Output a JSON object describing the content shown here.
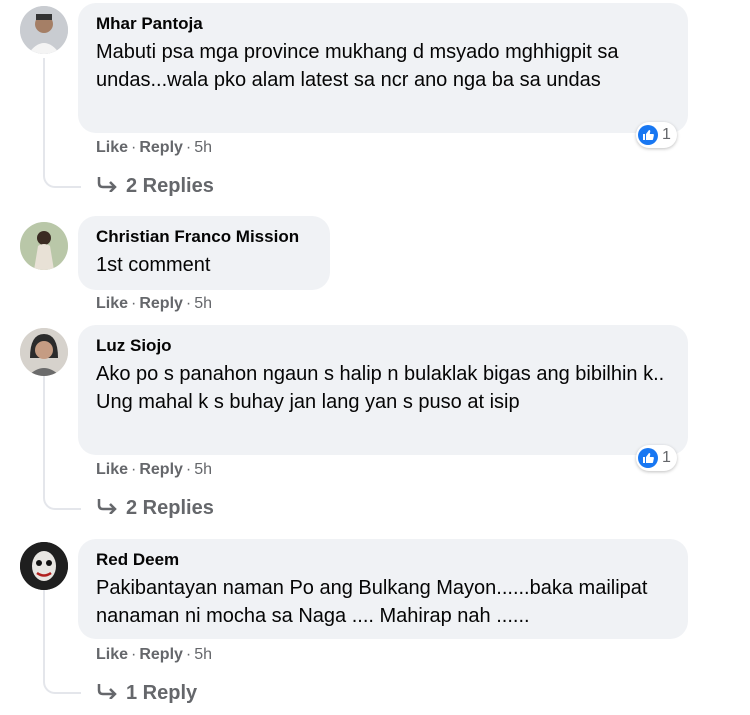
{
  "colors": {
    "bubble_bg": "#f0f2f5",
    "meta_text": "#65676b",
    "like_blue": "#1877f2"
  },
  "comments": [
    {
      "author": "Mhar Pantoja",
      "text": "Mabuti psa mga province mukhang d msyado mghhigpit sa undas...wala pko alam latest sa ncr ano nga ba sa undas",
      "like": "Like",
      "reply": "Reply",
      "time": "5h",
      "reaction_count": "1",
      "replies": "2 Replies"
    },
    {
      "author": "Christian Franco Mission",
      "text": "1st comment",
      "like": "Like",
      "reply": "Reply",
      "time": "5h"
    },
    {
      "author": "Luz Siojo",
      "text": "Ako po s panahon ngaun s halip n bulaklak bigas ang bibilhin k.. Ung mahal k s buhay jan lang yan s puso at isip",
      "like": "Like",
      "reply": "Reply",
      "time": "5h",
      "reaction_count": "1",
      "replies": "2 Replies"
    },
    {
      "author": "Red Deem",
      "text": "Pakibantayan naman Po ang Bulkang Mayon......baka mailipat nanaman ni mocha sa Naga .... Mahirap nah ......",
      "like": "Like",
      "reply": "Reply",
      "time": "5h",
      "replies": "1 Reply"
    }
  ]
}
